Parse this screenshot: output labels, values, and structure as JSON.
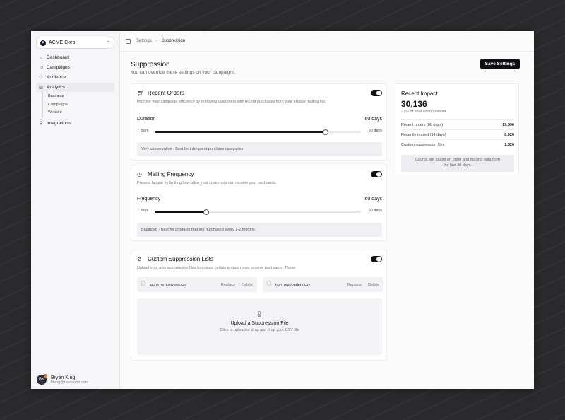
{
  "sidebar": {
    "org": {
      "name": "ACME Corp",
      "initial": "A"
    },
    "items": [
      {
        "label": "Dashboard",
        "icon": "home-icon"
      },
      {
        "label": "Campaigns",
        "icon": "megaphone-icon"
      },
      {
        "label": "Audience",
        "icon": "users-icon"
      },
      {
        "label": "Analytics",
        "icon": "chart-icon"
      },
      {
        "label": "Integrations",
        "icon": "link-icon"
      }
    ],
    "analytics_sub": [
      "Business",
      "Campaigns",
      "Website"
    ],
    "user": {
      "name": "Bryan King",
      "email": "bking@navutone.com",
      "initials": "BK"
    }
  },
  "breadcrumb": {
    "parent": "Settings",
    "current": "Suppression"
  },
  "page": {
    "title": "Suppression",
    "subtitle": "You can override these settings on your campaigns.",
    "save_label": "Save Settings"
  },
  "recent_orders": {
    "title": "Recent Orders",
    "description": "Improve your campaign efficiency by removing customers with recent purchases from your eligible mailing list.",
    "slider_label": "Duration",
    "value_label": "60 days",
    "min_label": "7 days",
    "max_label": "90 days",
    "fraction": 0.83,
    "note": "Very conservative - Best for infrequent purchase categories"
  },
  "mailing_frequency": {
    "title": "Mailing Frequency",
    "description": "Prevent fatigue by limiting how often your customers can receive your post cards.",
    "slider_label": "Frequency",
    "value_label": "60 days",
    "min_label": "7 days",
    "max_label": "90 days",
    "fraction": 0.25,
    "note": "Balanced - Best for products that are purchased every 1-2 months"
  },
  "custom_lists": {
    "title": "Custom Suppression Lists",
    "description": "Upload your own suppression files to ensure certain groups never receive post cards. These",
    "files": [
      {
        "name": "acme_employees.csv",
        "replace": "Replace",
        "delete": "Delete"
      },
      {
        "name": "non_responders.csv",
        "replace": "Replace",
        "delete": "Delete"
      }
    ],
    "upload_title": "Upload a Suppression File",
    "upload_sub": "Click to upload or drag and drop your CSV file"
  },
  "impact": {
    "title": "Recent Impact",
    "total": "30,136",
    "total_sub": "27% of total addressables",
    "stats": [
      {
        "label": "Recent orders (60 days)",
        "value": "19,890"
      },
      {
        "label": "Recently mailed (14 days)",
        "value": "8,920"
      },
      {
        "label": "Custom suppression files",
        "value": "1,326"
      }
    ],
    "note": "Counts are based on order and mailing data from the last 30 days."
  }
}
